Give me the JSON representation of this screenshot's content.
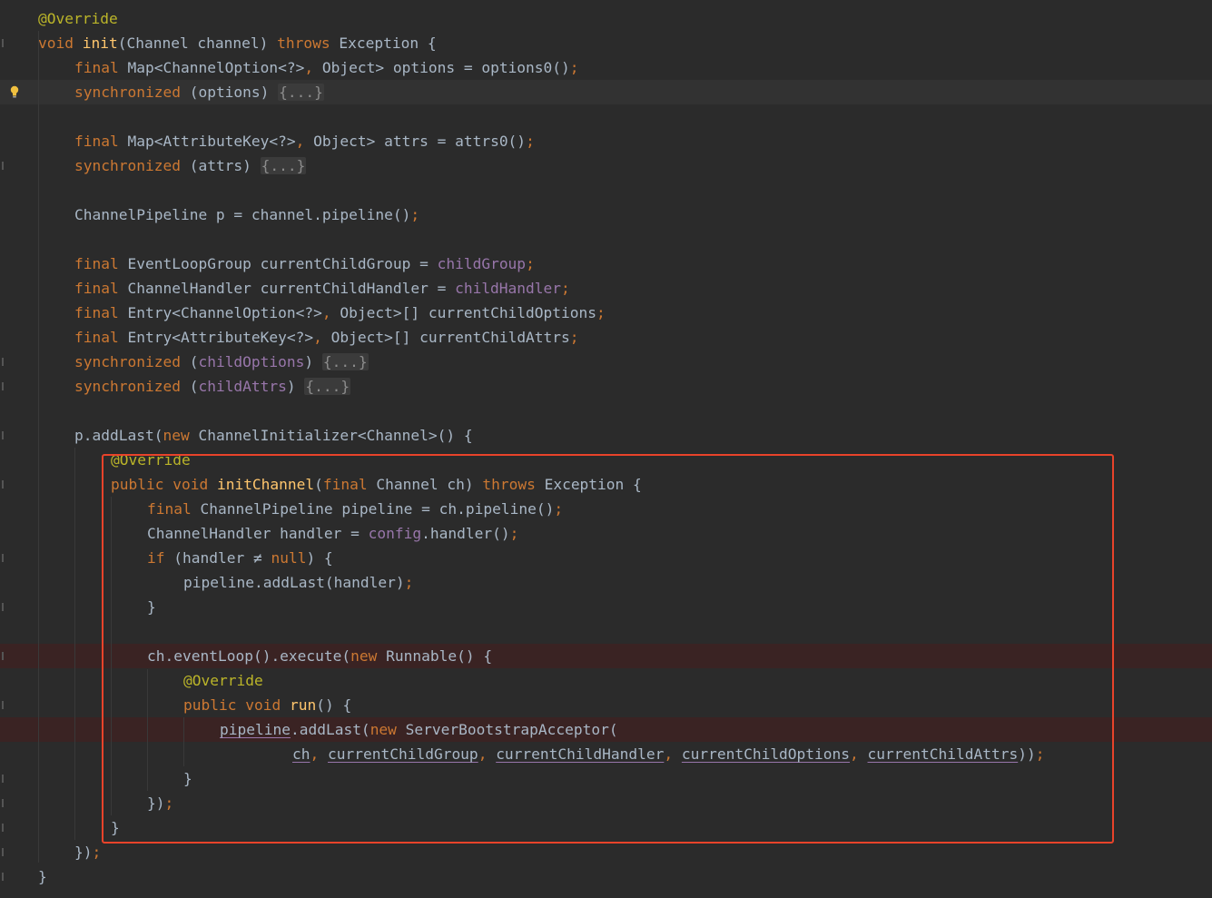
{
  "editor": {
    "lines": [
      {
        "segments": [
          [
            "ann",
            "@Override"
          ]
        ]
      },
      {
        "segments": [
          [
            "kw",
            "void "
          ],
          [
            "fn",
            "init"
          ],
          [
            "def",
            "(Channel channel) "
          ],
          [
            "kw",
            "throws "
          ],
          [
            "def",
            "Exception {"
          ]
        ]
      },
      {
        "segments": [
          [
            "kw",
            "final "
          ],
          [
            "def",
            "Map<ChannelOption<?>"
          ],
          [
            "kw",
            ", "
          ],
          [
            "def",
            "Object> options = options0()"
          ],
          [
            "kw",
            ";"
          ]
        ]
      },
      {
        "segments": [
          [
            "kw",
            "synchronized "
          ],
          [
            "def",
            "(options) "
          ],
          [
            "folded",
            "{...}"
          ]
        ]
      },
      {
        "segments": []
      },
      {
        "segments": [
          [
            "kw",
            "final "
          ],
          [
            "def",
            "Map<AttributeKey<?>"
          ],
          [
            "kw",
            ", "
          ],
          [
            "def",
            "Object> attrs = attrs0()"
          ],
          [
            "kw",
            ";"
          ]
        ]
      },
      {
        "segments": [
          [
            "kw",
            "synchronized "
          ],
          [
            "def",
            "(attrs) "
          ],
          [
            "folded",
            "{...}"
          ]
        ]
      },
      {
        "segments": []
      },
      {
        "segments": [
          [
            "def",
            "ChannelPipeline p = channel.pipeline()"
          ],
          [
            "kw",
            ";"
          ]
        ]
      },
      {
        "segments": []
      },
      {
        "segments": [
          [
            "kw",
            "final "
          ],
          [
            "def",
            "EventLoopGroup currentChildGroup = "
          ],
          [
            "fld",
            "childGroup"
          ],
          [
            "kw",
            ";"
          ]
        ]
      },
      {
        "segments": [
          [
            "kw",
            "final "
          ],
          [
            "def",
            "ChannelHandler currentChildHandler = "
          ],
          [
            "fld",
            "childHandler"
          ],
          [
            "kw",
            ";"
          ]
        ]
      },
      {
        "segments": [
          [
            "kw",
            "final "
          ],
          [
            "def",
            "Entry<ChannelOption<?>"
          ],
          [
            "kw",
            ", "
          ],
          [
            "def",
            "Object>[] currentChildOptions"
          ],
          [
            "kw",
            ";"
          ]
        ]
      },
      {
        "segments": [
          [
            "kw",
            "final "
          ],
          [
            "def",
            "Entry<AttributeKey<?>"
          ],
          [
            "kw",
            ", "
          ],
          [
            "def",
            "Object>[] currentChildAttrs"
          ],
          [
            "kw",
            ";"
          ]
        ]
      },
      {
        "segments": [
          [
            "kw",
            "synchronized "
          ],
          [
            "def",
            "("
          ],
          [
            "fld",
            "childOptions"
          ],
          [
            "def",
            ") "
          ],
          [
            "folded",
            "{...}"
          ]
        ]
      },
      {
        "segments": [
          [
            "kw",
            "synchronized "
          ],
          [
            "def",
            "("
          ],
          [
            "fld",
            "childAttrs"
          ],
          [
            "def",
            ") "
          ],
          [
            "folded",
            "{...}"
          ]
        ]
      },
      {
        "segments": []
      },
      {
        "segments": [
          [
            "def",
            "p.addLast("
          ],
          [
            "kw",
            "new "
          ],
          [
            "def",
            "ChannelInitializer<Channel>() {"
          ]
        ]
      },
      {
        "segments": [
          [
            "ann",
            "@Override"
          ]
        ]
      },
      {
        "segments": [
          [
            "kw",
            "public void "
          ],
          [
            "fn",
            "initChannel"
          ],
          [
            "def",
            "("
          ],
          [
            "kw",
            "final "
          ],
          [
            "def",
            "Channel ch) "
          ],
          [
            "kw",
            "throws "
          ],
          [
            "def",
            "Exception {"
          ]
        ]
      },
      {
        "segments": [
          [
            "kw",
            "final "
          ],
          [
            "def",
            "ChannelPipeline pipeline = ch.pipeline()"
          ],
          [
            "kw",
            ";"
          ]
        ]
      },
      {
        "segments": [
          [
            "def",
            "ChannelHandler handler = "
          ],
          [
            "fld",
            "config"
          ],
          [
            "def",
            ".handler()"
          ],
          [
            "kw",
            ";"
          ]
        ]
      },
      {
        "segments": [
          [
            "kw",
            "if "
          ],
          [
            "def",
            "(handler ≠ "
          ],
          [
            "kw",
            "null"
          ],
          [
            "def",
            ") {"
          ]
        ]
      },
      {
        "segments": [
          [
            "def",
            "pipeline.addLast(handler)"
          ],
          [
            "kw",
            ";"
          ]
        ]
      },
      {
        "segments": [
          [
            "def",
            "}"
          ]
        ]
      },
      {
        "segments": []
      },
      {
        "segments": [
          [
            "def",
            "ch.eventLoop().execute("
          ],
          [
            "kw",
            "new "
          ],
          [
            "def",
            "Runnable() {"
          ]
        ]
      },
      {
        "segments": [
          [
            "ann",
            "@Override"
          ]
        ]
      },
      {
        "segments": [
          [
            "kw",
            "public void "
          ],
          [
            "fn",
            "run"
          ],
          [
            "def",
            "() {"
          ]
        ]
      },
      {
        "segments": [
          [
            "cap",
            "pipeline"
          ],
          [
            "def",
            ".addLast("
          ],
          [
            "kw",
            "new "
          ],
          [
            "def",
            "ServerBootstrapAcceptor("
          ]
        ]
      },
      {
        "segments": [
          [
            "cap",
            "ch"
          ],
          [
            "kw",
            ", "
          ],
          [
            "cap",
            "currentChildGroup"
          ],
          [
            "kw",
            ", "
          ],
          [
            "cap",
            "currentChildHandler"
          ],
          [
            "kw",
            ", "
          ],
          [
            "cap",
            "currentChildOptions"
          ],
          [
            "kw",
            ", "
          ],
          [
            "cap",
            "currentChildAttrs"
          ],
          [
            "def",
            "))"
          ],
          [
            "kw",
            ";"
          ]
        ]
      },
      {
        "segments": [
          [
            "def",
            "}"
          ]
        ]
      },
      {
        "segments": [
          [
            "def",
            "})"
          ],
          [
            "kw",
            ";"
          ]
        ]
      },
      {
        "segments": [
          [
            "def",
            "}"
          ]
        ]
      },
      {
        "segments": [
          [
            "def",
            "})"
          ],
          [
            "kw",
            ";"
          ]
        ]
      },
      {
        "segments": [
          [
            "def",
            "}"
          ]
        ]
      }
    ],
    "gutter_icons": [
      "lightbulb-icon",
      "fold-marker-icon"
    ],
    "colors": {
      "background": "#2b2b2b",
      "keyword": "#cc7832",
      "annotation": "#bbb529",
      "method": "#ffc66d",
      "field": "#9876aa",
      "text": "#a9b7c6",
      "highlight_box": "#e8432a",
      "breakpoint_line": "#3a2323",
      "caret_line": "#323232"
    }
  }
}
